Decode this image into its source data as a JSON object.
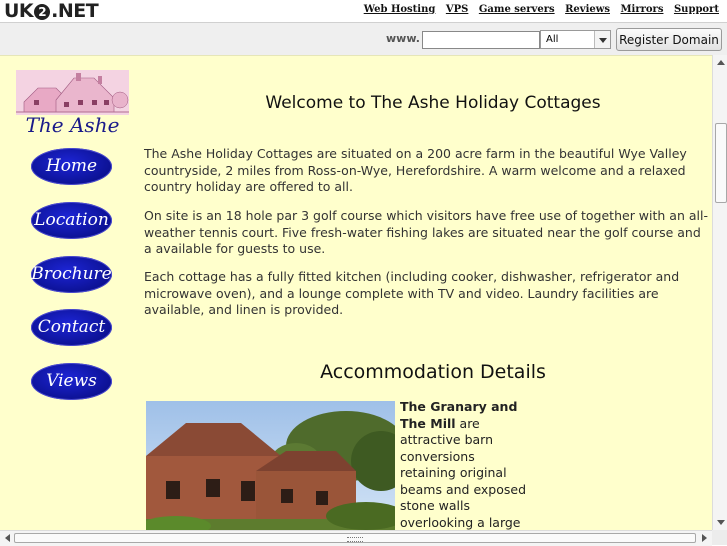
{
  "site": {
    "logo_left": "UK",
    "logo_mid": "2",
    "logo_right": ".NET"
  },
  "toplinks": [
    {
      "label": "Web Hosting"
    },
    {
      "label": "VPS"
    },
    {
      "label": "Game servers"
    },
    {
      "label": "Reviews"
    },
    {
      "label": "Mirrors"
    },
    {
      "label": "Support"
    }
  ],
  "domain": {
    "www_label": "www.",
    "input_value": "",
    "tld_selected": "All",
    "register_label": "Register Domain"
  },
  "sidebar": {
    "logo_title": "The Ashe",
    "nav": [
      {
        "label": "Home"
      },
      {
        "label": "Location"
      },
      {
        "label": "Brochure"
      },
      {
        "label": "Contact"
      },
      {
        "label": "Views"
      }
    ]
  },
  "main": {
    "welcome": "Welcome to The Ashe Holiday Cottages",
    "para1": "The Ashe Holiday Cottages are situated on a 200 acre farm in the beautiful Wye Valley countryside, 2 miles from Ross-on-Wye, Herefordshire. A warm welcome and a relaxed country holiday are offered to all.",
    "para2": "On site is an 18 hole par 3 golf course which visitors have free use of together with an all-weather tennis court.  Five fresh-water fishing lakes are situated near the golf course and a available for guests to use.",
    "para3": "Each cottage has a fully fitted kitchen (including cooker, dishwasher, refrigerator and microwave oven), and a lounge complete with TV and video. Laundry facilities are available, and linen is provided.",
    "accommodation_heading": "Accommodation Details",
    "cottage_bold": "The Granary and The Mill",
    "cottage_text": " are attractive barn conversions retaining original beams and exposed stone walls overlooking a large"
  },
  "colors": {
    "page_bg": "#ffffcc",
    "nav_button": "#0b108f",
    "logo_text": "#1a1a8a"
  }
}
